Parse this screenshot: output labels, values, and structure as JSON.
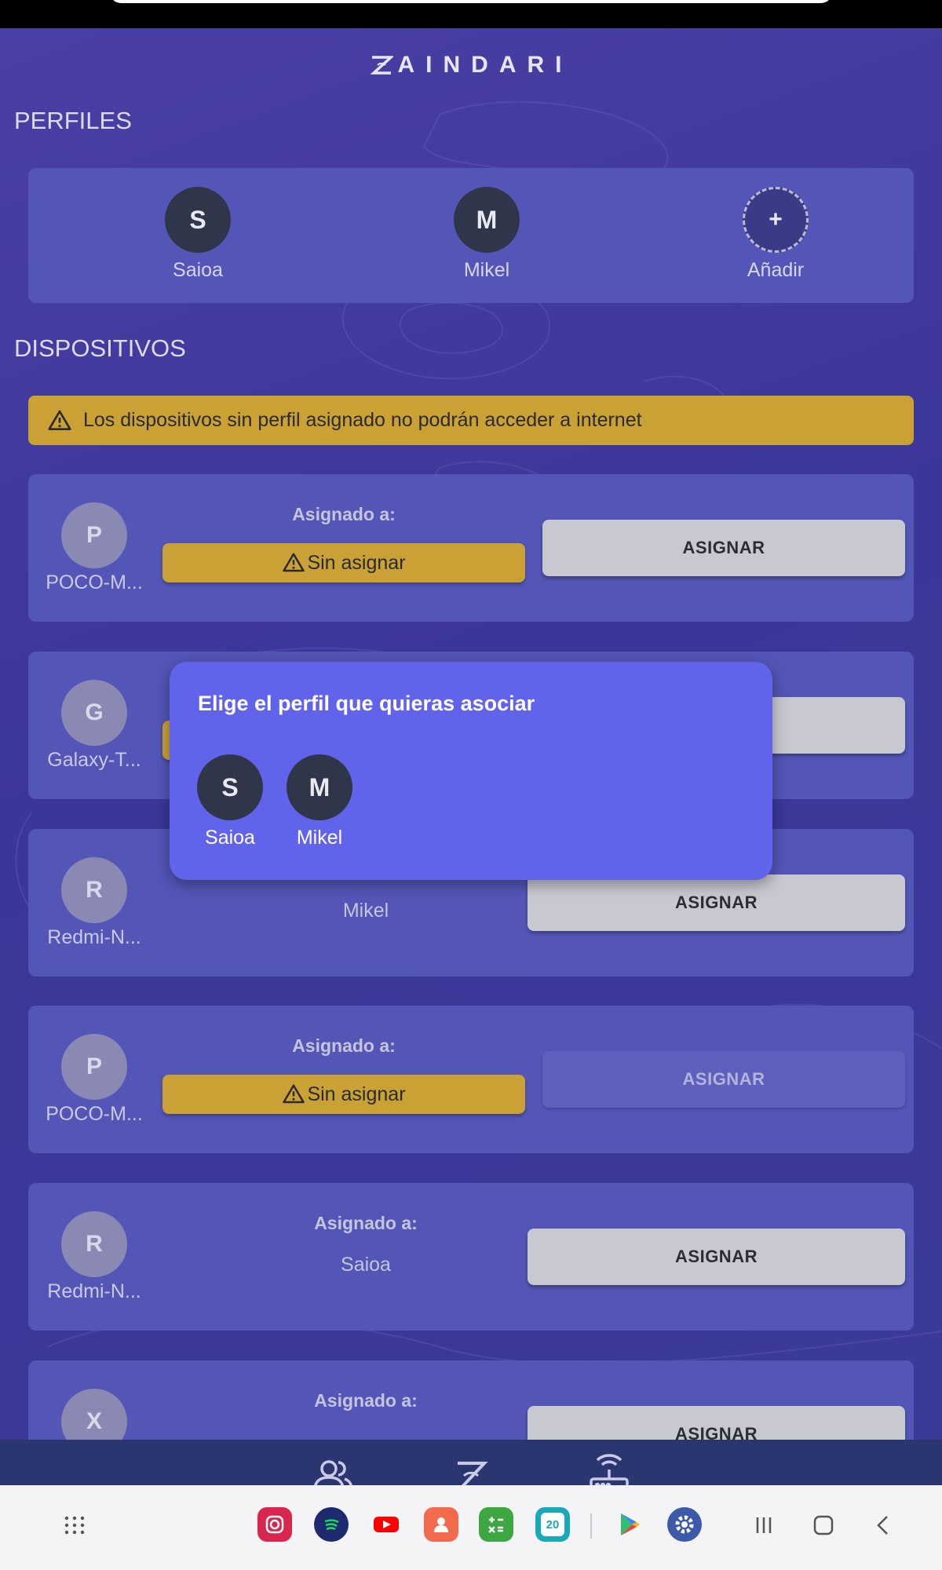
{
  "app": {
    "brand": "AINDARI"
  },
  "profiles": {
    "title": "PERFILES",
    "items": [
      {
        "initial": "S",
        "name": "Saioa"
      },
      {
        "initial": "M",
        "name": "Mikel"
      }
    ],
    "add": {
      "symbol": "+",
      "label": "Añadir"
    }
  },
  "devices": {
    "title": "DISPOSITIVOS",
    "warning": "Los dispositivos sin perfil asignado no podrán acceder a internet",
    "assigned_label": "Asignado a:",
    "unassigned_text": "Sin asignar",
    "assign_button": "ASIGNAR",
    "items": [
      {
        "initial": "P",
        "name": "POCO-M...",
        "assigned": ""
      },
      {
        "initial": "G",
        "name": "Galaxy-T...",
        "assigned": ""
      },
      {
        "initial": "R",
        "name": "Redmi-N...",
        "assigned": "Mikel"
      },
      {
        "initial": "P",
        "name": "POCO-M...",
        "assigned": ""
      },
      {
        "initial": "R",
        "name": "Redmi-N...",
        "assigned": "Saioa"
      },
      {
        "initial": "X",
        "name": "",
        "assigned": ""
      }
    ],
    "partial_label": "Asignado a:"
  },
  "modal": {
    "title": "Elige el perfil que quieras asociar",
    "options": [
      {
        "initial": "S",
        "name": "Saioa"
      },
      {
        "initial": "M",
        "name": "Mikel"
      }
    ]
  },
  "bottom_nav": {
    "icons": [
      "profiles-icon",
      "aindari-logo-icon",
      "router-icon"
    ]
  },
  "system_bar": {
    "apps": [
      "instagram-icon",
      "spotify-icon",
      "youtube-icon",
      "contacts-icon",
      "calculator-icon",
      "calendar-icon",
      "play-store-icon",
      "settings-icon"
    ],
    "calendar_day": "20",
    "accent": "#6163eb",
    "warning_color": "#c9a134"
  }
}
